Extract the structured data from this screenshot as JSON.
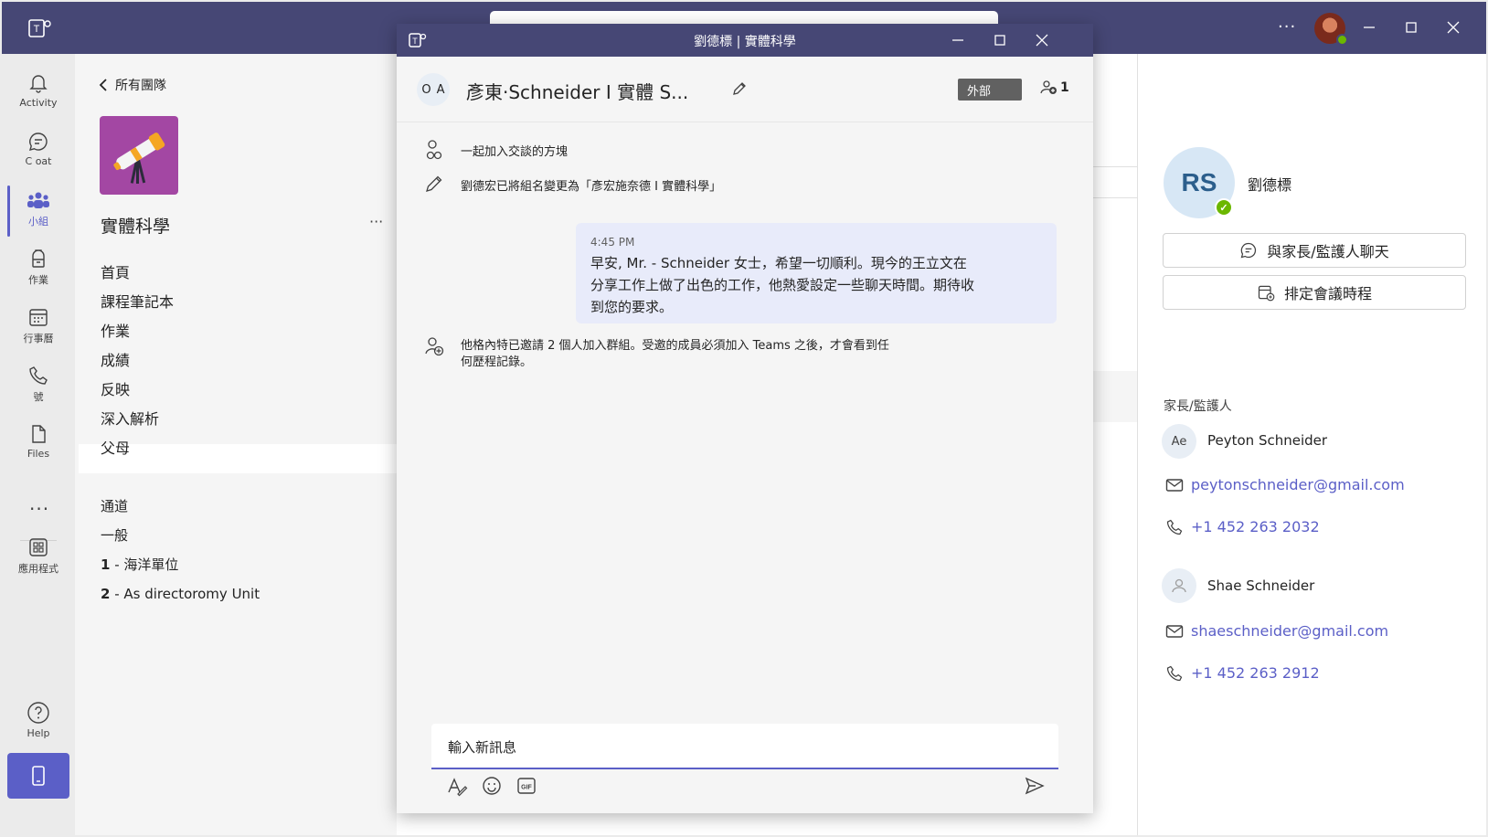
{
  "window": {
    "chat_popout_title": "劉德標 | 實體科學"
  },
  "rail": {
    "items": [
      {
        "label": "Activity",
        "icon": "bell-icon"
      },
      {
        "label": "C oat",
        "icon": "chat-icon"
      },
      {
        "label": "小組",
        "icon": "teams-icon",
        "active": true
      },
      {
        "label": "作業",
        "icon": "backpack-icon"
      },
      {
        "label": "行事曆",
        "icon": "calendar-icon"
      },
      {
        "label": "號",
        "icon": "phone-icon"
      },
      {
        "label": "Files",
        "icon": "file-icon"
      },
      {
        "label": "應用程式",
        "icon": "apps-icon"
      }
    ],
    "help_label": "Help"
  },
  "team_panel": {
    "back_label": "所有團隊",
    "team_name": "實體科學",
    "nav_items": [
      "首頁",
      "課程筆記本",
      "作業",
      "成績",
      "反映",
      "深入解析",
      "父母"
    ],
    "active_nav": "父母",
    "channels_header": "通道",
    "channels": [
      {
        "num": "",
        "name": "一般"
      },
      {
        "num": "1",
        "name": " - 海洋單位"
      },
      {
        "num": "2",
        "name": " - As directoromy Unit"
      }
    ]
  },
  "chat": {
    "group_avatar_letters": [
      "O",
      "A"
    ],
    "title": "彥東·Schneider I 實體 S...",
    "external_badge": "外部",
    "participant_count": "1",
    "events": [
      {
        "icon": "people-icon",
        "text": "一起加入交談的方塊"
      },
      {
        "icon": "pencil-icon",
        "text": "劉德宏已將組名變更為「彥宏施奈德 I 實體科學」"
      }
    ],
    "message": {
      "time": "4:45 PM",
      "text": "早安, Mr. - Schneider 女士，希望一切順利。現今的王立文在分享工作上做了出色的工作，他熱愛設定一些聊天時間。期待收到您的要求。"
    },
    "invite_event": {
      "icon": "add-person-icon",
      "text": "他格內特已邀請 2 個人加入群組。受邀的成員必須加入 Teams 之後，才會看到任何歷程記錄。"
    },
    "compose_placeholder": "輸入新訊息"
  },
  "right_panel": {
    "avatar_initials": "RS",
    "name": "劉德標",
    "chat_button": "與家長/監護人聊天",
    "schedule_button": "排定會議時程",
    "section_label": "家長/監護人",
    "guardians": [
      {
        "initials": "Ae",
        "name": "Peyton Schneider",
        "email": "peytonschneider@gmail.com",
        "phone": "+1 452 263 2032"
      },
      {
        "initials": "",
        "name": "Shae Schneider",
        "email": "shaeschneider@gmail.com",
        "phone": "+1 452 263 2912"
      }
    ]
  },
  "colors": {
    "titlebar": "#464775",
    "accent": "#5b5fc7",
    "message_bubble": "#e8ebfa",
    "presence": "#6bb700"
  }
}
